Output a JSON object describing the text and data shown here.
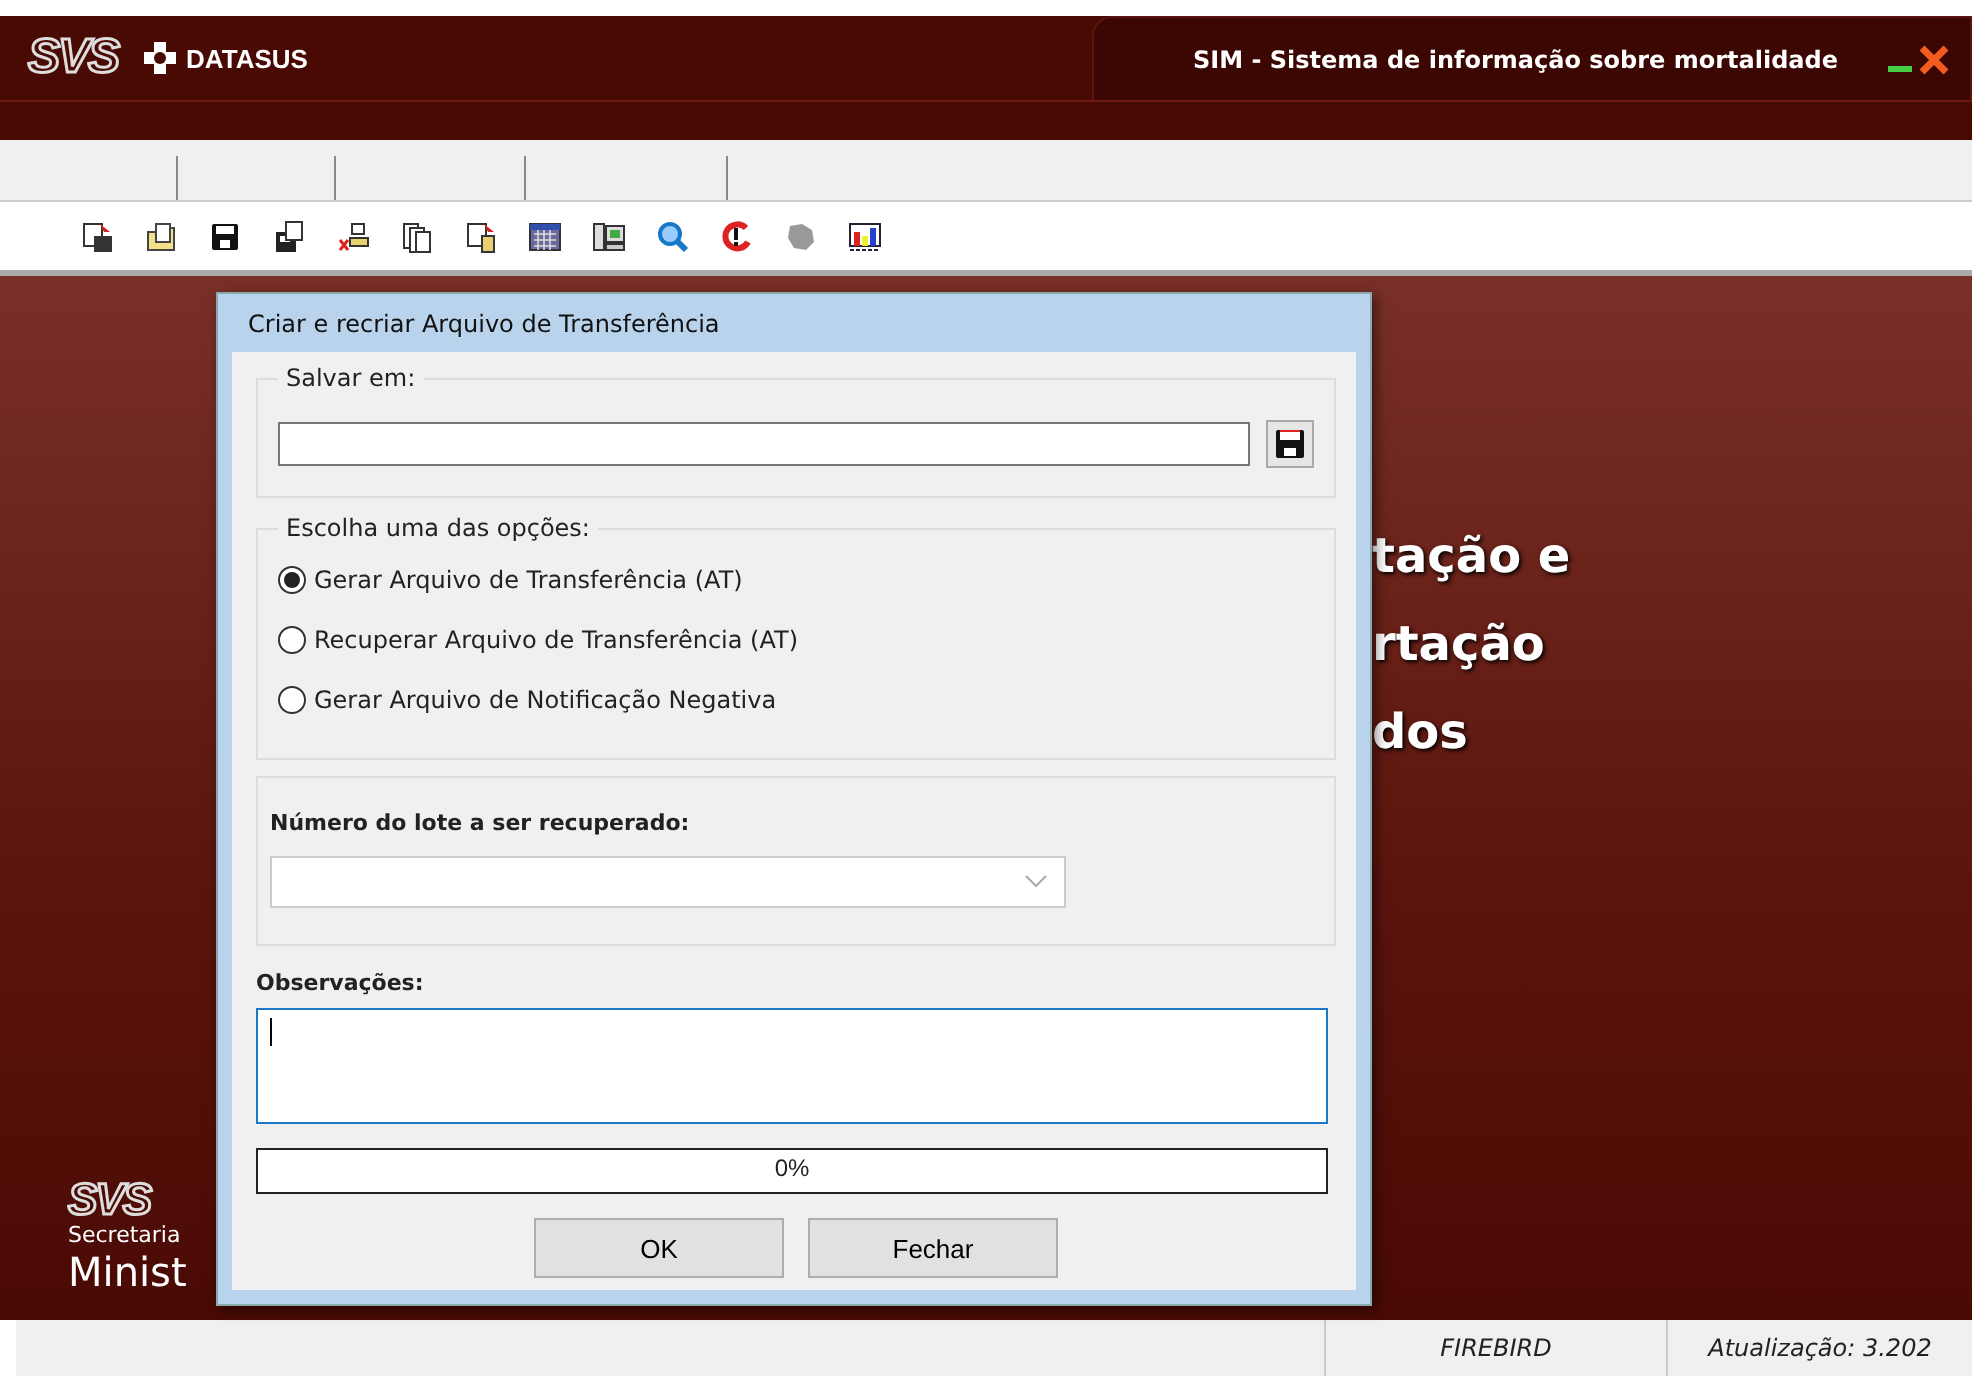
{
  "header": {
    "logo_text": "SVS",
    "brand": "DATASUS",
    "app_title": "SIM - Sistema de informação sobre mortalidade"
  },
  "background": {
    "lines": [
      "tação e",
      "rtação",
      "dos"
    ],
    "footer_logo": "SVS",
    "footer_line1": "Secretaria",
    "footer_line2": "Minist"
  },
  "dialog": {
    "title": "Criar e recriar Arquivo de Transferência",
    "save_group": {
      "legend": "Salvar em:"
    },
    "options_group": {
      "legend": "Escolha uma das opções:",
      "options": [
        {
          "label": "Gerar Arquivo de Transferência (AT)",
          "selected": true
        },
        {
          "label": "Recuperar Arquivo de Transferência (AT)",
          "selected": false
        },
        {
          "label": "Gerar Arquivo de Notificação Negativa",
          "selected": false
        }
      ]
    },
    "batch": {
      "label": "Número do lote a ser recuperado:",
      "disabled": true
    },
    "notes": {
      "label": "Observações:"
    },
    "progress": {
      "level": 0,
      "reading": "0%"
    },
    "buttons": [
      "OK",
      "Fechar"
    ]
  },
  "status_bar": {
    "database": "FIREBIRD",
    "version": "Atualização: 3.202"
  }
}
